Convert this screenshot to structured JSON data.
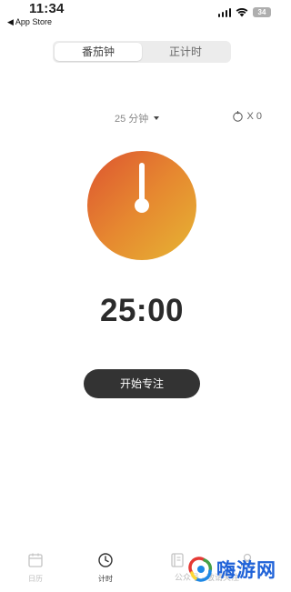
{
  "status_bar": {
    "time": "11:34",
    "back_label": "◀ App Store",
    "battery": "34"
  },
  "segment": {
    "tabs": [
      {
        "label": "番茄钟",
        "active": true
      },
      {
        "label": "正计时",
        "active": false
      }
    ]
  },
  "timer": {
    "duration_label": "25 分钟",
    "tomato_count": "X 0",
    "countdown": "25:00",
    "start_label": "开始专注"
  },
  "dial": {
    "gradient_colors": [
      "#dd5430",
      "#e68830",
      "#e6b533"
    ]
  },
  "tab_bar": {
    "items": [
      {
        "label": "日历",
        "icon": "calendar-icon",
        "active": false
      },
      {
        "label": "计时",
        "icon": "clock-icon",
        "active": true
      },
      {
        "label": "",
        "icon": "notebook-icon",
        "active": false
      },
      {
        "label": "",
        "icon": "person-icon",
        "active": false
      }
    ]
  },
  "watermark": {
    "brand": "嗨游网",
    "overlay_text": "公众号 · 敬请关注"
  }
}
